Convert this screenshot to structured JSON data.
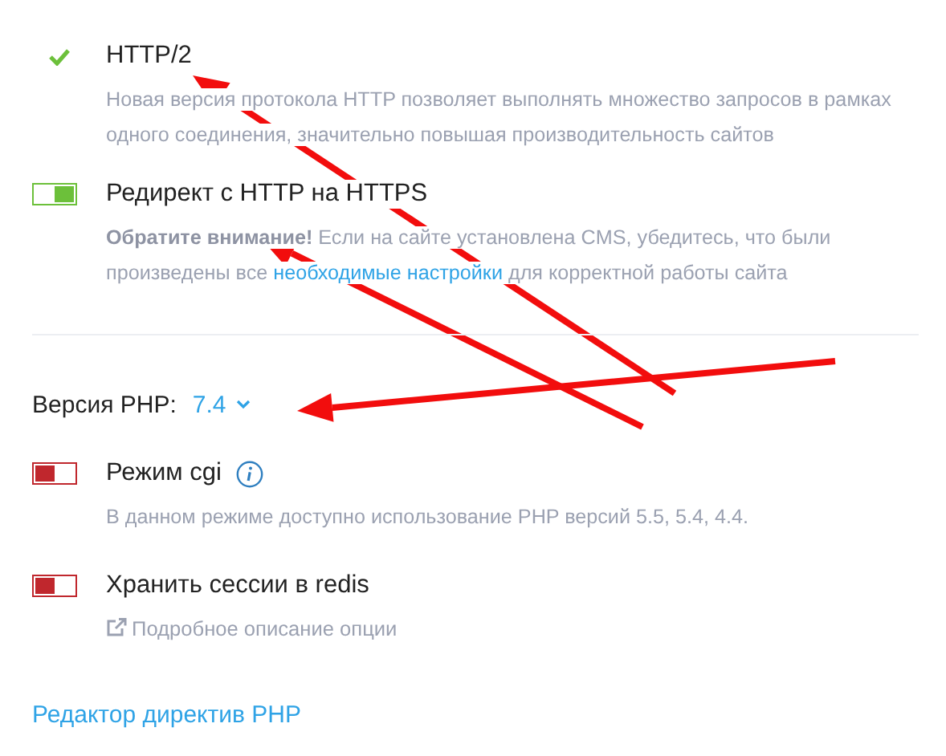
{
  "settings": [
    {
      "kind": "check",
      "title": "HTTP/2",
      "description": [
        {
          "kind": "plain",
          "text": "Новая версия протокола HTTP позволяет выполнять множество запросов в рамках одного соединения, значительно повышая производительность сайтов"
        }
      ]
    },
    {
      "kind": "toggle",
      "on": true,
      "title": "Редирект с HTTP на HTTPS",
      "description": [
        {
          "kind": "bold",
          "text": "Обратите внимание!"
        },
        {
          "kind": "plain",
          "text": " Если на сайте установлена CMS, убедитесь, что были произведены все "
        },
        {
          "kind": "link",
          "text": "необходимые настройки"
        },
        {
          "kind": "plain",
          "text": " для корректной работы сайта"
        }
      ]
    }
  ],
  "php_version": {
    "label": "Версия PHP:",
    "value": "7.4"
  },
  "options": [
    {
      "kind": "toggle",
      "on": false,
      "title": "Режим cgi",
      "info": true,
      "description": [
        {
          "kind": "plain",
          "text": "В данном режиме доступно использование PHP версий 5.5, 5.4, 4.4."
        }
      ]
    },
    {
      "kind": "toggle",
      "on": false,
      "title": "Хранить сессии в redis",
      "info": false,
      "details_link": "Подробное описание опции"
    }
  ],
  "editor_link": "Редактор директив PHP"
}
